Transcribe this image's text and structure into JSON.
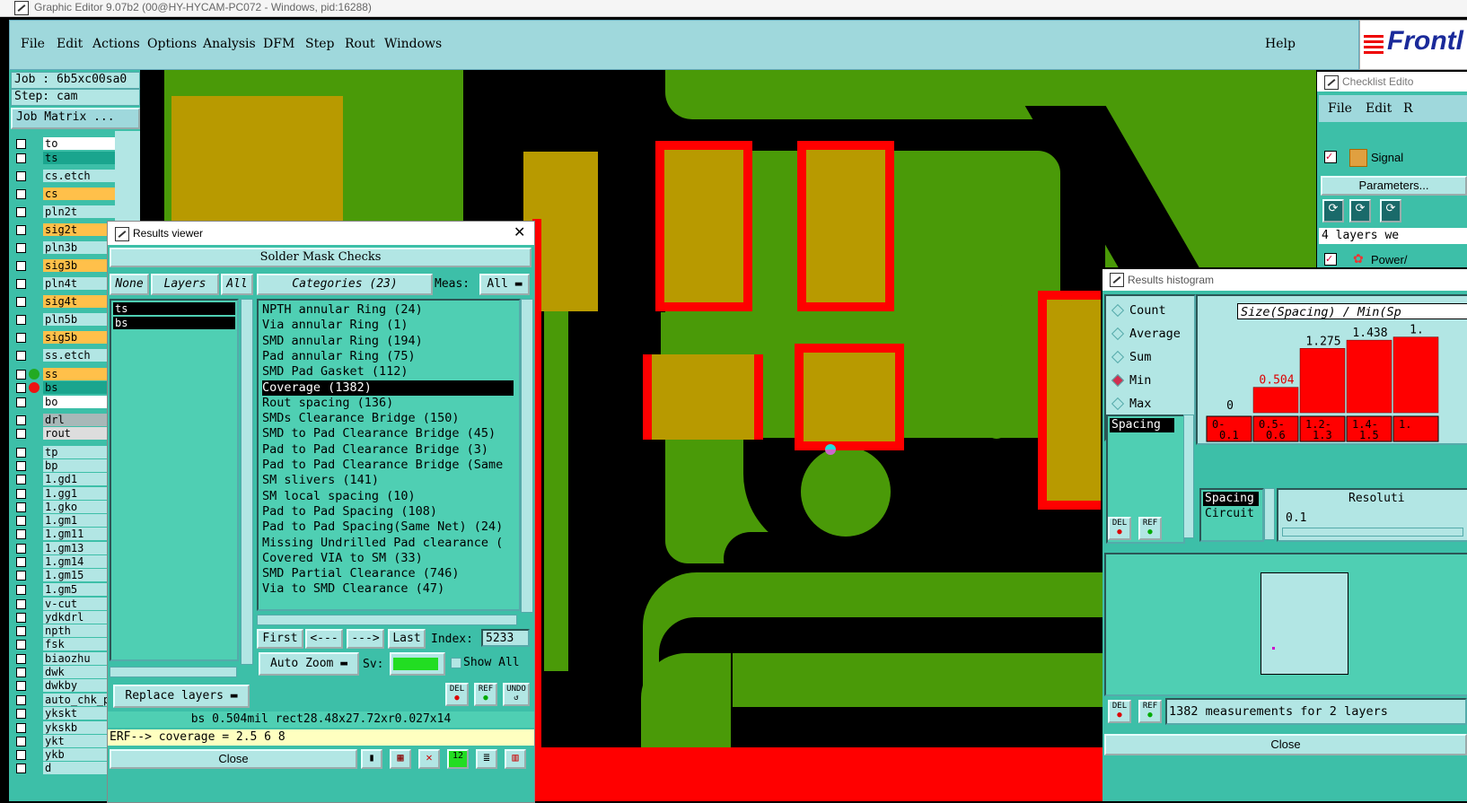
{
  "window": {
    "title": "Graphic Editor 9.07b2 (00@HY-HYCAM-PC072 - Windows, pid:16288)"
  },
  "menubar": {
    "items": [
      "File",
      "Edit",
      "Actions",
      "Options",
      "Analysis",
      "DFM",
      "Step",
      "Rout",
      "Windows"
    ],
    "help": "Help",
    "logo": "Frontl"
  },
  "job": {
    "job_label": "Job : 6b5xc00sa0",
    "step_label": "Step: cam",
    "matrix_button": "Job Matrix ..."
  },
  "layers": [
    {
      "name": "to",
      "bg": "#ffffff"
    },
    {
      "name": "ts",
      "bg": "#1aa58e"
    },
    {
      "name": "cs.etch",
      "bg": "#b2e6e4"
    },
    {
      "name": "cs",
      "bg": "#ffc04a"
    },
    {
      "name": "pln2t",
      "bg": "#b2e6e4"
    },
    {
      "name": "sig2t",
      "bg": "#ffc04a"
    },
    {
      "name": "pln3b",
      "bg": "#b2e6e4"
    },
    {
      "name": "sig3b",
      "bg": "#ffc04a"
    },
    {
      "name": "pln4t",
      "bg": "#b2e6e4"
    },
    {
      "name": "sig4t",
      "bg": "#ffc04a"
    },
    {
      "name": "pln5b",
      "bg": "#b2e6e4"
    },
    {
      "name": "sig5b",
      "bg": "#ffc04a"
    },
    {
      "name": "ss.etch",
      "bg": "#b2e6e4"
    },
    {
      "name": "ss",
      "bg": "#ffc04a",
      "dot": "#22aa22"
    },
    {
      "name": "bs",
      "bg": "#1aa58e",
      "dot": "#ee1111"
    },
    {
      "name": "bo",
      "bg": "#ffffff"
    },
    {
      "name": "drl",
      "bg": "#a8b8b8"
    },
    {
      "name": "rout",
      "bg": "#dddddd"
    },
    {
      "name": "tp",
      "bg": "#b2e6e4"
    },
    {
      "name": "bp",
      "bg": "#b2e6e4"
    },
    {
      "name": "1.gd1",
      "bg": "#b2e6e4"
    },
    {
      "name": "1.gg1",
      "bg": "#b2e6e4"
    },
    {
      "name": "1.gko",
      "bg": "#b2e6e4"
    },
    {
      "name": "1.gm1",
      "bg": "#b2e6e4"
    },
    {
      "name": "1.gm11",
      "bg": "#b2e6e4"
    },
    {
      "name": "1.gm13",
      "bg": "#b2e6e4"
    },
    {
      "name": "1.gm14",
      "bg": "#b2e6e4"
    },
    {
      "name": "1.gm15",
      "bg": "#b2e6e4"
    },
    {
      "name": "1.gm5",
      "bg": "#b2e6e4"
    },
    {
      "name": "v-cut",
      "bg": "#b2e6e4"
    },
    {
      "name": "ydkdrl",
      "bg": "#b2e6e4"
    },
    {
      "name": "npth",
      "bg": "#b2e6e4"
    },
    {
      "name": "fsk",
      "bg": "#b2e6e4"
    },
    {
      "name": "biaozhu",
      "bg": "#b2e6e4"
    },
    {
      "name": "dwk",
      "bg": "#b2e6e4"
    },
    {
      "name": "dwkby",
      "bg": "#b2e6e4"
    },
    {
      "name": "auto_chk_pr",
      "bg": "#b2e6e4"
    },
    {
      "name": "ykskt",
      "bg": "#b2e6e4"
    },
    {
      "name": "ykskb",
      "bg": "#b2e6e4"
    },
    {
      "name": "ykt",
      "bg": "#b2e6e4"
    },
    {
      "name": "ykb",
      "bg": "#b2e6e4"
    },
    {
      "name": "d",
      "bg": "#b2e6e4"
    }
  ],
  "results_viewer": {
    "title": "Results viewer",
    "group": "Solder Mask Checks",
    "none_btn": "None",
    "layers_btn": "Layers",
    "all_btn": "All",
    "categories_btn": "Categories (23)",
    "meas_label": "Meas:",
    "meas_value": "All",
    "layer_list": [
      "ts",
      "bs"
    ],
    "categories": [
      "NPTH annular Ring (24)",
      "Via annular Ring (1)",
      "SMD annular Ring (194)",
      "Pad annular Ring (75)",
      "SMD Pad Gasket (112)",
      "Coverage (1382)",
      "Rout spacing (136)",
      "SMDs Clearance Bridge (150)",
      "SMD to Pad Clearance Bridge (45)",
      "Pad to Pad Clearance Bridge (3)",
      "Pad to Pad Clearance Bridge (Same",
      "SM slivers (141)",
      "SM local spacing (10)",
      "Pad to Pad Spacing (108)",
      "Pad to Pad Spacing(Same Net) (24)",
      "Missing Undrilled Pad clearance (",
      "Covered VIA to SM (33)",
      "SMD Partial Clearance (746)",
      "Via to SMD Clearance (47)"
    ],
    "selected_category": "Coverage (1382)",
    "nav": {
      "first": "First",
      "prev": "<---",
      "next": "--->",
      "last": "Last",
      "index_label": "Index:",
      "index_value": "5233"
    },
    "auto_zoom": "Auto Zoom",
    "sv_label": "Sv:",
    "sv_color": "#22dd22",
    "show_all": "Show All",
    "replace_layers": "Replace layers",
    "del": "DEL",
    "ref": "REF",
    "undo": "UNDO",
    "status": "bs 0.504mil   rect28.48x27.72xr0.027x14",
    "erf": "ERF--> coverage = 2.5 6 8",
    "close": "Close"
  },
  "checklist": {
    "title": "Checklist Edito",
    "menu": [
      "File",
      "Edit",
      "R"
    ],
    "signal": "Signal",
    "parameters": "Parameters...",
    "layers_note": "4 layers we",
    "power": "Power/"
  },
  "histogram": {
    "title": "Results histogram",
    "modes": [
      "Count",
      "Average",
      "Sum",
      "Min",
      "Max"
    ],
    "selected_mode": "Min",
    "type_list": [
      "Spacing"
    ],
    "header": "Size(Spacing) / Min(Sp",
    "measure_list": [
      "Spacing",
      "Circuit"
    ],
    "resolution_label": "Resoluti",
    "resolution_value": "0.1",
    "footer": "1382 measurements for 2 layers",
    "close": "Close",
    "del": "DEL",
    "ref": "REF"
  },
  "chart_data": {
    "type": "bar",
    "categories": [
      "0-0.1",
      "0.5-0.6",
      "1.2-1.3",
      "1.4-1.5",
      "1."
    ],
    "values": [
      0,
      0.504,
      1.275,
      1.438,
      1.5
    ],
    "value_labels": [
      "0",
      "0.504",
      "1.275",
      "1.438",
      "1."
    ],
    "title": "Size(Spacing) / Min(Sp",
    "ylim": [
      0,
      1.6
    ]
  },
  "colors": {
    "panel": "#3dbfa8",
    "widget": "#b2e6e4",
    "copper": "#4a9a08",
    "pad": "#b89a00",
    "highlight": "#ff0000"
  }
}
